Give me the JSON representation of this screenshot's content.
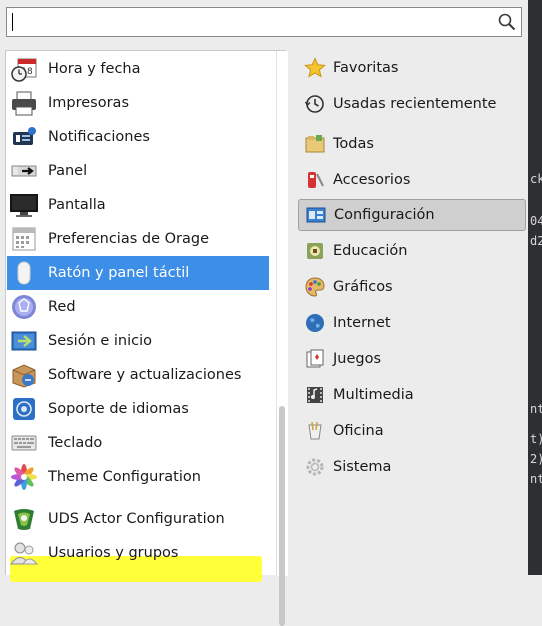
{
  "search": {
    "value": "",
    "placeholder": ""
  },
  "apps": [
    {
      "label": "Hora y fecha",
      "icon": "calendar-clock-icon"
    },
    {
      "label": "Impresoras",
      "icon": "printer-icon"
    },
    {
      "label": "Notificaciones",
      "icon": "notification-icon"
    },
    {
      "label": "Panel",
      "icon": "panel-icon"
    },
    {
      "label": "Pantalla",
      "icon": "monitor-icon"
    },
    {
      "label": "Preferencias de Orage",
      "icon": "orage-calendar-icon"
    },
    {
      "label": "Ratón y panel táctil",
      "icon": "mouse-icon",
      "selected": true
    },
    {
      "label": "Red",
      "icon": "network-icon"
    },
    {
      "label": "Sesión e inicio",
      "icon": "session-icon"
    },
    {
      "label": "Software y actualizaciones",
      "icon": "software-update-icon"
    },
    {
      "label": "Soporte de idiomas",
      "icon": "language-support-icon"
    },
    {
      "label": "Teclado",
      "icon": "keyboard-icon"
    },
    {
      "label": "Theme Configuration",
      "icon": "theme-flower-icon"
    },
    {
      "label": "UDS Actor Configuration",
      "icon": "uds-actor-icon",
      "highlighted": true
    },
    {
      "label": "Usuarios y grupos",
      "icon": "users-icon"
    }
  ],
  "categories": [
    {
      "label": "Favoritas",
      "icon": "star-icon"
    },
    {
      "label": "Usadas recientemente",
      "icon": "history-icon"
    },
    {
      "label": "Todas",
      "icon": "folder-all-icon"
    },
    {
      "label": "Accesorios",
      "icon": "accessories-icon"
    },
    {
      "label": "Configuración",
      "icon": "settings-icon",
      "active": true
    },
    {
      "label": "Educación",
      "icon": "education-icon"
    },
    {
      "label": "Gráficos",
      "icon": "graphics-palette-icon"
    },
    {
      "label": "Internet",
      "icon": "globe-icon"
    },
    {
      "label": "Juegos",
      "icon": "games-icon"
    },
    {
      "label": "Multimedia",
      "icon": "multimedia-icon"
    },
    {
      "label": "Oficina",
      "icon": "office-icon"
    },
    {
      "label": "Sistema",
      "icon": "system-gear-icon"
    }
  ],
  "terminal": {
    "fragments": [
      "ck",
      "04",
      "d2",
      "nt",
      "t)",
      "2)",
      "nt"
    ]
  },
  "colors": {
    "selection": "#3d8ee6",
    "highlight": "#ffff3a",
    "active_category": "#cfcfcf"
  }
}
